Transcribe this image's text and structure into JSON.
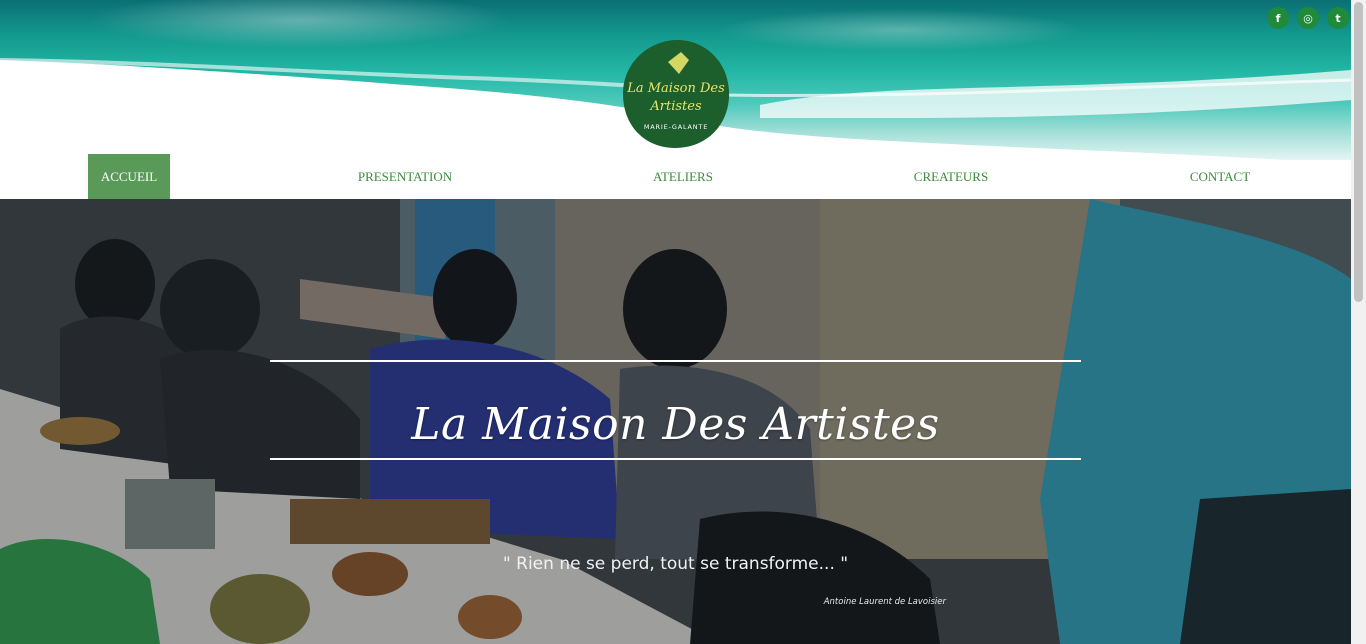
{
  "brand": {
    "logo_line1": "La Maison Des",
    "logo_line2": "Artistes",
    "logo_location": "MARIE-GALANTE"
  },
  "social": [
    {
      "icon": "facebook-icon",
      "glyph": "f"
    },
    {
      "icon": "instagram-icon",
      "glyph": "◎"
    },
    {
      "icon": "twitter-icon",
      "glyph": "t"
    }
  ],
  "nav": {
    "items": [
      "ACCUEIL",
      "PRESENTATION",
      "ATELIERS",
      "CREATEURS",
      "CONTACT"
    ],
    "active": "ACCUEIL"
  },
  "hero": {
    "title": "La Maison Des Artistes",
    "quote": "\" Rien ne se perd, tout se transforme... \"",
    "author": "Antoine Laurent de Lavoisier"
  },
  "colors": {
    "accent_green": "#5a9a59",
    "nav_text": "#3d8b3b",
    "logo_green": "#1c5e2c",
    "logo_text": "#e9e46a"
  }
}
